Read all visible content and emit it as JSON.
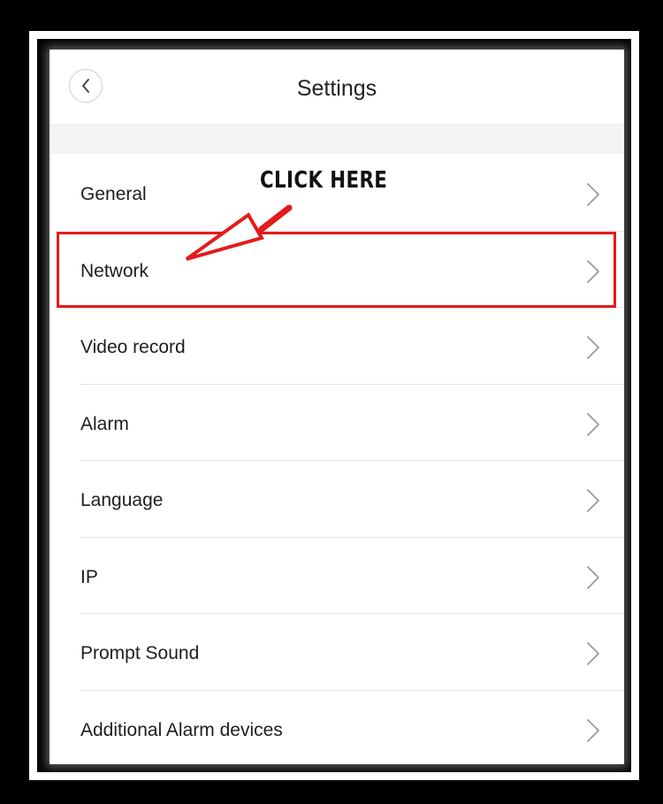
{
  "header": {
    "title": "Settings",
    "back_icon": "chevron-left-icon"
  },
  "menu": {
    "items": [
      {
        "label": "General"
      },
      {
        "label": "Network"
      },
      {
        "label": "Video record"
      },
      {
        "label": "Alarm"
      },
      {
        "label": "Language"
      },
      {
        "label": "IP"
      },
      {
        "label": "Prompt Sound"
      },
      {
        "label": "Additional Alarm devices"
      }
    ],
    "chevron_icon": "chevron-right-icon"
  },
  "annotation": {
    "text": "CLICK HERE",
    "highlighted_item": "Network",
    "highlight_color": "#e31b1b"
  },
  "colors": {
    "background": "#ffffff",
    "frame": "#000000",
    "section_gap": "#f4f4f5",
    "divider": "#e6e6e6",
    "text": "#1e1e1e"
  }
}
